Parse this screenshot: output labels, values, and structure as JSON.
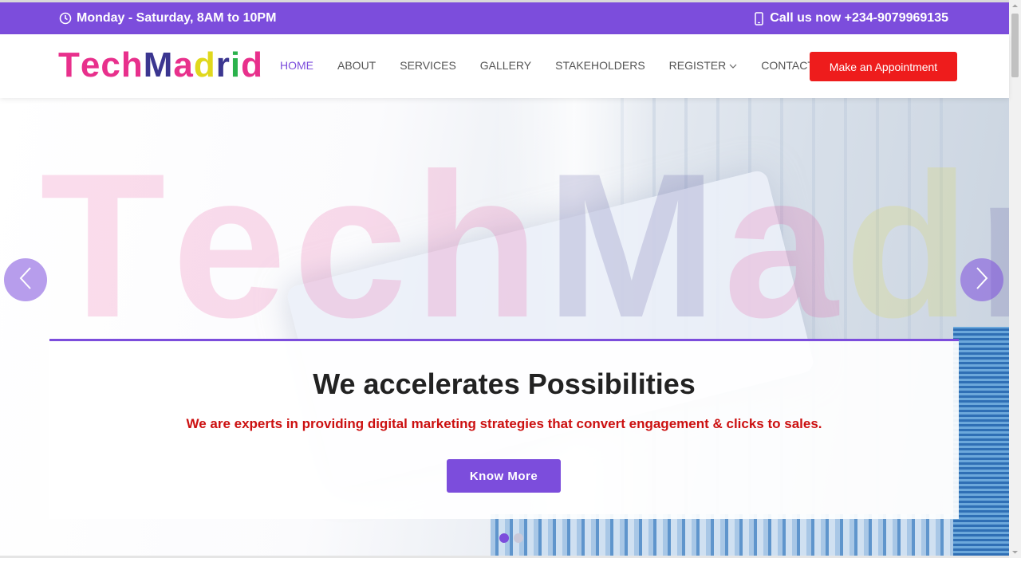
{
  "topbar": {
    "hours_text": "Monday - Saturday, 8AM to 10PM",
    "phone_text": "Call us now +234-9079969135",
    "icons": [
      "clock-icon",
      "phone-icon"
    ]
  },
  "logo": {
    "letters": [
      {
        "ch": "T",
        "color": "#e8308c"
      },
      {
        "ch": "e",
        "color": "#e8308c"
      },
      {
        "ch": "c",
        "color": "#e8308c"
      },
      {
        "ch": "h",
        "color": "#e8308c"
      },
      {
        "ch": "M",
        "color": "#3b3690"
      },
      {
        "ch": "a",
        "color": "#e8308c"
      },
      {
        "ch": "d",
        "color": "#e0d81c"
      },
      {
        "ch": "r",
        "color": "#3b3690"
      },
      {
        "ch": "i",
        "color": "#2bb24c"
      },
      {
        "ch": "d",
        "color": "#e8308c"
      }
    ]
  },
  "nav": {
    "items": [
      {
        "label": "HOME",
        "active": true
      },
      {
        "label": "ABOUT"
      },
      {
        "label": "SERVICES"
      },
      {
        "label": "GALLERY"
      },
      {
        "label": "STAKEHOLDERS"
      },
      {
        "label": "REGISTER",
        "dropdown": true
      },
      {
        "label": "CONTACT"
      }
    ],
    "appointment_label": "Make an Appointment"
  },
  "hero": {
    "title": "We accelerates Possibilities",
    "subtitle": "We are experts in providing digital marketing strategies that convert engagement & clicks to sales.",
    "button_label": "Know More",
    "slides_count": 2,
    "active_slide": 1
  },
  "colors": {
    "accent": "#7c4ddc",
    "cta_red": "#ee1c1c",
    "subtitle_red": "#cc1010"
  }
}
